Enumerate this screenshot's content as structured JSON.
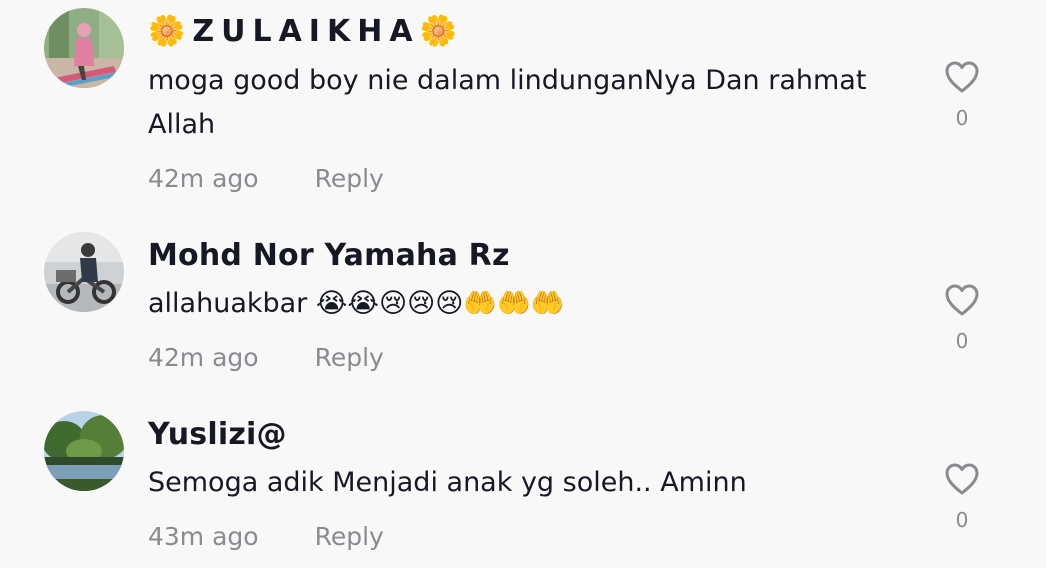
{
  "comments": [
    {
      "username": "🌼ZULAIKHA🌼",
      "text": "moga good boy nie dalam lindunganNya Dan rahmat Allah",
      "time": "42m ago",
      "reply": "Reply",
      "likes": "0"
    },
    {
      "username": "Mohd Nor Yamaha Rz",
      "text": "allahuakbar 😭😭😢😢😢🤲🤲🤲",
      "time": "42m ago",
      "reply": "Reply",
      "likes": "0"
    },
    {
      "username": "Yuslizi@",
      "text": "Semoga adik Menjadi anak yg soleh.. Aminn",
      "time": "43m ago",
      "reply": "Reply",
      "likes": "0"
    }
  ],
  "icons": {
    "like": "heart-outline-icon"
  },
  "colors": {
    "background": "#f8f8f8",
    "text": "#161823",
    "muted": "#8a8b91"
  }
}
